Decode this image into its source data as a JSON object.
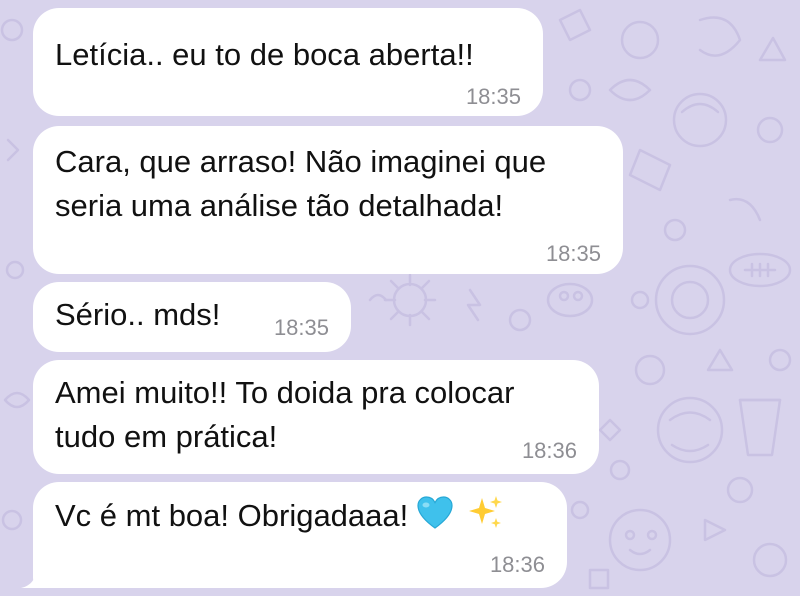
{
  "chat": {
    "messages": [
      {
        "text": "Letícia.. eu to de boca aberta!!",
        "time": "18:35"
      },
      {
        "lines": [
          "Cara, que arraso! Não imaginei que",
          "seria uma análise tão detalhada!"
        ],
        "time": "18:35"
      },
      {
        "text": "Sério.. mds!",
        "time": "18:35"
      },
      {
        "lines": [
          "Amei muito!! To doida pra colocar",
          "tudo em prática!"
        ],
        "time": "18:36"
      },
      {
        "text": "Vc é mt boa! Obrigadaaa!",
        "emojis": [
          "blue-heart-icon",
          "sparkles-icon"
        ],
        "time": "18:36"
      }
    ]
  },
  "colors": {
    "wallpaper": "#d8d3ec",
    "bubble": "#ffffff",
    "text": "#111111",
    "timestamp": "#8e8e93"
  }
}
